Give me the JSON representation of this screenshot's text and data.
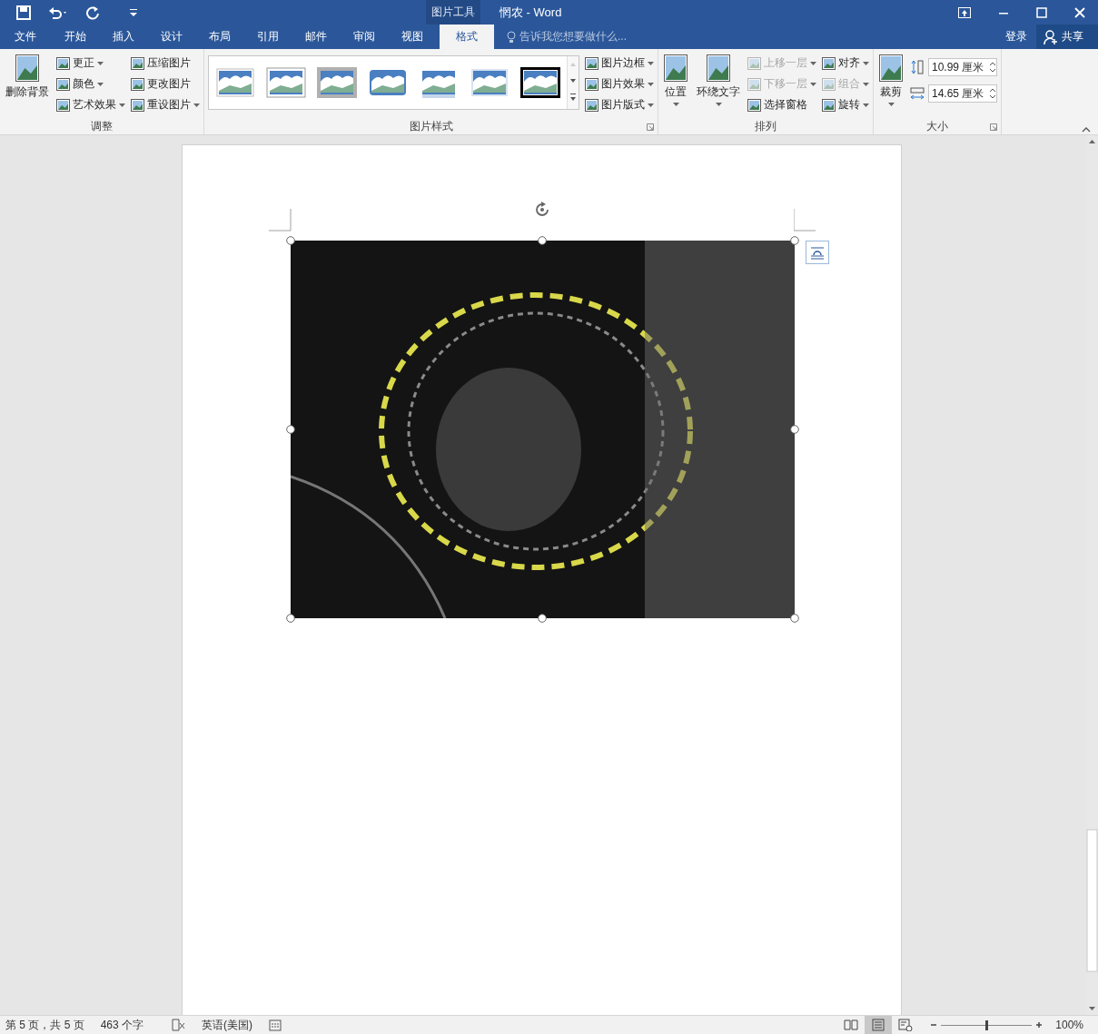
{
  "title_bar": {
    "contextual_tab": "图片工具",
    "title": "惘农 - Word"
  },
  "tabs": [
    {
      "label": "文件",
      "selected": false
    },
    {
      "label": "开始",
      "selected": false
    },
    {
      "label": "插入",
      "selected": false
    },
    {
      "label": "设计",
      "selected": false
    },
    {
      "label": "布局",
      "selected": false
    },
    {
      "label": "引用",
      "selected": false
    },
    {
      "label": "邮件",
      "selected": false
    },
    {
      "label": "审阅",
      "selected": false
    },
    {
      "label": "视图",
      "selected": false
    },
    {
      "label": "格式",
      "selected": true
    }
  ],
  "tell_me": {
    "placeholder": "告诉我您想要做什么..."
  },
  "account": {
    "sign_in": "登录",
    "share": "共享"
  },
  "ribbon": {
    "groups": [
      {
        "label": "调整",
        "launcher": false,
        "sections": [
          {
            "kind": "large",
            "items": [
              {
                "label": "删除背景",
                "dropdown": false,
                "disabled": false
              }
            ]
          },
          {
            "kind": "stack",
            "items": [
              {
                "label": "更正",
                "dropdown": true,
                "disabled": false
              },
              {
                "label": "颜色",
                "dropdown": true,
                "disabled": false
              },
              {
                "label": "艺术效果",
                "dropdown": true,
                "disabled": false
              }
            ]
          },
          {
            "kind": "stack",
            "items": [
              {
                "label": "压缩图片",
                "dropdown": false,
                "disabled": false
              },
              {
                "label": "更改图片",
                "dropdown": false,
                "disabled": false
              },
              {
                "label": "重设图片",
                "dropdown": true,
                "disabled": false
              }
            ]
          }
        ]
      },
      {
        "label": "图片样式",
        "launcher": true,
        "sections": [
          {
            "kind": "gallery",
            "items": [
              {
                "kind": "shadow"
              },
              {
                "kind": "frame"
              },
              {
                "kind": "matte"
              },
              {
                "kind": "rounded"
              },
              {
                "kind": "reflect"
              },
              {
                "kind": "soft"
              },
              {
                "kind": "black"
              }
            ]
          },
          {
            "kind": "stack",
            "items": [
              {
                "label": "图片边框",
                "dropdown": true,
                "disabled": false
              },
              {
                "label": "图片效果",
                "dropdown": true,
                "disabled": false
              },
              {
                "label": "图片版式",
                "dropdown": true,
                "disabled": false
              }
            ]
          }
        ]
      },
      {
        "label": "排列",
        "launcher": false,
        "sections": [
          {
            "kind": "large",
            "items": [
              {
                "label": "位置",
                "dropdown": true,
                "disabled": false
              },
              {
                "label": "环绕文字",
                "dropdown": true,
                "disabled": false
              }
            ]
          },
          {
            "kind": "stack",
            "items": [
              {
                "label": "上移一层",
                "dropdown": true,
                "disabled": true
              },
              {
                "label": "下移一层",
                "dropdown": true,
                "disabled": true
              },
              {
                "label": "选择窗格",
                "dropdown": false,
                "disabled": false
              }
            ]
          },
          {
            "kind": "stack",
            "items": [
              {
                "label": "对齐",
                "dropdown": true,
                "disabled": false
              },
              {
                "label": "组合",
                "dropdown": true,
                "disabled": true
              },
              {
                "label": "旋转",
                "dropdown": true,
                "disabled": false
              }
            ]
          }
        ]
      },
      {
        "label": "大小",
        "launcher": true,
        "sections": [
          {
            "kind": "large",
            "items": [
              {
                "label": "裁剪",
                "dropdown": true,
                "disabled": false
              }
            ]
          },
          {
            "kind": "spin",
            "items": [
              {
                "value": "10.99 厘米"
              },
              {
                "value": "14.65 厘米"
              }
            ]
          }
        ]
      }
    ]
  },
  "status_bar": {
    "page": "第 5 页，共 5 页",
    "words": "463 个字",
    "language": "英语(美国)",
    "views": [
      {
        "selected": false
      },
      {
        "selected": true
      },
      {
        "selected": false
      }
    ],
    "zoom": {
      "level": 0.5,
      "reading": "100%"
    }
  }
}
